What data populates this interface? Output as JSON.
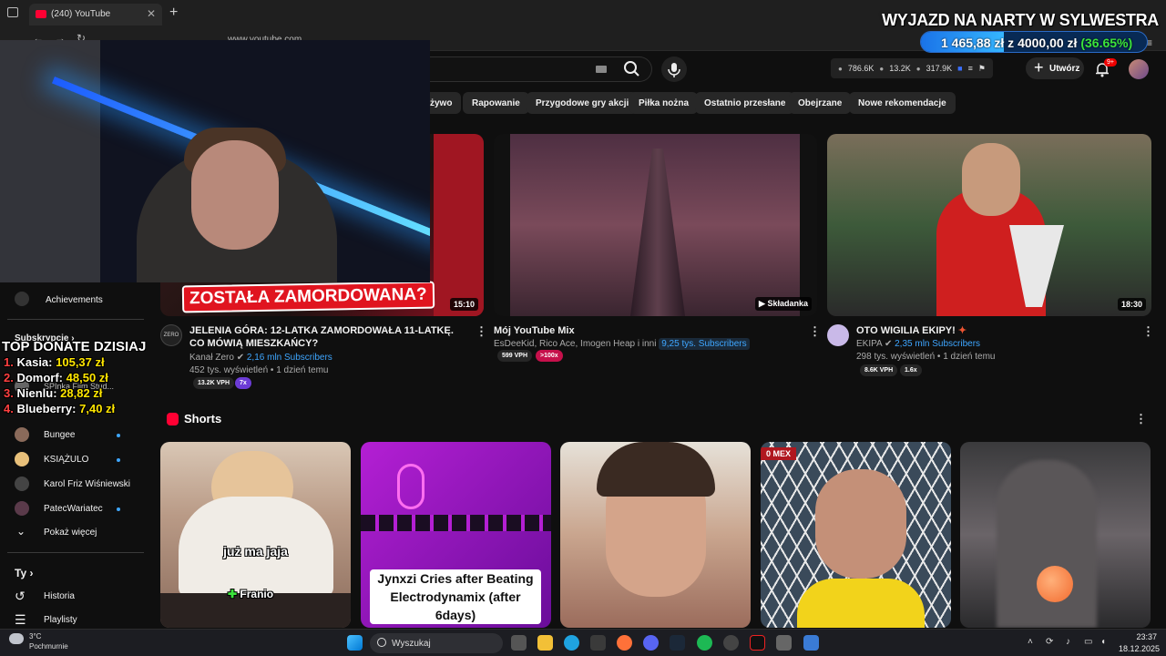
{
  "browser": {
    "tab_title": "(240) YouTube",
    "url": "www.youtube.com"
  },
  "goal": {
    "title": "WYJAZD NA NARTY W SYLWESTRA",
    "current": "1 465,88 zł",
    "separator": "z",
    "target": "4000,00 zł",
    "percent_label": "(36.65%)",
    "progress_fraction": 0.3665
  },
  "header": {
    "stats": [
      "786.6K",
      "13.2K",
      "317.9K"
    ],
    "create_label": "Utwórz",
    "notification_count": "9+"
  },
  "chips": [
    "żywo",
    "Rapowanie",
    "Przygodowe gry akcji",
    "Piłka nożna",
    "Ostatnio przesłane",
    "Obejrzane",
    "Nowe rekomendacje"
  ],
  "videos": [
    {
      "overlay_text": "ZOSTAŁA ZAMORDOWANA?",
      "duration": "15:10",
      "title": "JELENIA GÓRA: 12-LATKA ZAMORDOWAŁA 11-LATKĘ. CO MÓWIĄ MIESZKAŃCY?",
      "channel": "Kanał Zero",
      "subs": "2,16 mln Subscribers",
      "meta": "452 tys. wyświetleń • 1 dzień temu",
      "vph": "13.2K VPH",
      "mult": "7x",
      "avatar_label": "ZERO"
    },
    {
      "duration": "Składanka",
      "title": "Mój YouTube Mix",
      "channel": "EsDeeKid, Rico Ace, Imogen Heap i inni",
      "subs": "9,25 tys. Subscribers",
      "vph": "599 VPH",
      "mult": ">100x"
    },
    {
      "duration": "18:30",
      "title": "OTO WIGILIA EKIPY!",
      "channel": "EKIPA",
      "subs": "2,35 mln Subscribers",
      "meta": "298 tys. wyświetleń • 1 dzień temu",
      "vph": "8.6K VPH",
      "mult": "1.6x"
    }
  ],
  "sidebar": {
    "achievements": "Achievements",
    "subscriptions_heading": "Subskrypcje",
    "items": [
      "SPInka Film Stud...",
      "Bungee",
      "KSIĄŻULO",
      "Karol Friz Wiśniewski",
      "PatecWariatec"
    ],
    "show_more": "Pokaż więcej",
    "you_heading": "Ty",
    "history": "Historia",
    "playlists": "Playlisty"
  },
  "donates": {
    "heading": "TOP DONATE DZISIAJ",
    "entries": [
      {
        "num": "1.",
        "name": "Kasia:",
        "amount": "105,37 zł"
      },
      {
        "num": "2.",
        "name": "Domorf:",
        "amount": "48,50 zł"
      },
      {
        "num": "3.",
        "name": "Nienlu:",
        "amount": "28,82 zł"
      },
      {
        "num": "4.",
        "name": "Blueberry:",
        "amount": "7,40 zł"
      }
    ]
  },
  "shorts": {
    "heading": "Shorts",
    "items": [
      {
        "caption": "już ma jaja",
        "subcaption": "Franio"
      },
      {
        "caption": "Jynxzi Cries after Beating Electrodynamix (after 6days)"
      },
      {
        "caption": ""
      },
      {
        "caption": "0 MEX"
      },
      {
        "caption": ""
      }
    ]
  },
  "taskbar": {
    "weather_temp": "3°C",
    "weather_desc": "Pochmurnie",
    "search_label": "Wyszukaj",
    "time": "23:37",
    "date": "18.12.2025"
  },
  "colors": {
    "bg": "#0f0f0f",
    "accent_red": "#ff0033",
    "link_blue": "#3ea6ff",
    "goal_green": "#3be33b"
  }
}
